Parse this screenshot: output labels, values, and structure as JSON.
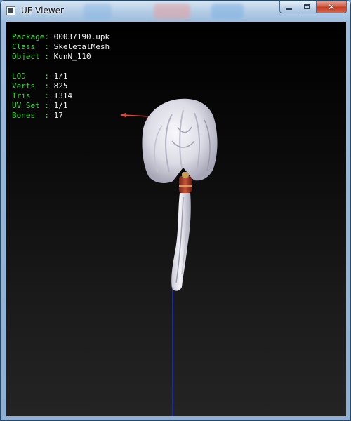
{
  "window": {
    "title": "UE Viewer",
    "close_glyph": "✕"
  },
  "info": {
    "package_label": "Package: ",
    "package_value": "00037190.upk",
    "class_label": "Class  : ",
    "class_value": "SkeletalMesh",
    "object_label": "Object : ",
    "object_value": "KunN_110",
    "lod_label": "LOD    : ",
    "lod_value": "1/1",
    "verts_label": "Verts  : ",
    "verts_value": "825",
    "tris_label": "Tris   : ",
    "tris_value": "1314",
    "uvset_label": "UV Set : ",
    "uvset_value": "1/1",
    "bones_label": "Bones  : ",
    "bones_value": "17"
  },
  "icons": {
    "app": "app-icon",
    "minimize": "minimize-icon",
    "maximize": "maximize-icon",
    "close": "close-icon"
  },
  "colors": {
    "label_green": "#46d046",
    "value_white": "#f2f2f2",
    "x_axis": "#e04b3c",
    "z_axis": "#1f2fd6",
    "mesh": "#e4e4ec"
  }
}
